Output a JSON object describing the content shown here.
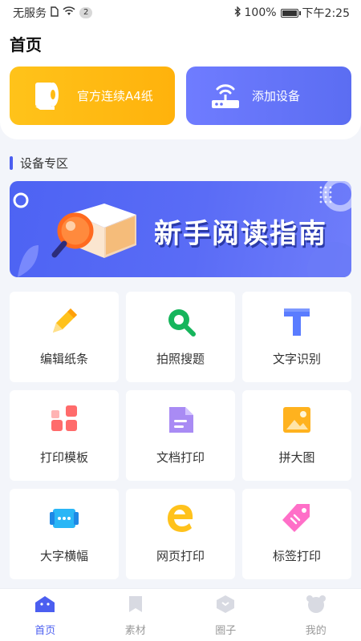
{
  "status_bar": {
    "carrier": "无服务",
    "notification_count": "2",
    "battery": "100%",
    "time": "下午2:25"
  },
  "header": {
    "title": "首页"
  },
  "quick_actions": [
    {
      "label": "官方连续A4纸",
      "icon": "paper-roll-icon",
      "color": "#ffbb14"
    },
    {
      "label": "添加设备",
      "icon": "router-icon",
      "color": "#6473f8"
    }
  ],
  "section": {
    "label": "设备专区"
  },
  "banner": {
    "text": "新手阅读指南"
  },
  "tools": [
    {
      "label": "编辑纸条",
      "icon": "pencil-icon"
    },
    {
      "label": "拍照搜题",
      "icon": "search-icon"
    },
    {
      "label": "文字识别",
      "icon": "text-t-icon"
    },
    {
      "label": "打印模板",
      "icon": "template-icon"
    },
    {
      "label": "文档打印",
      "icon": "document-icon"
    },
    {
      "label": "拼大图",
      "icon": "image-icon"
    },
    {
      "label": "大字横幅",
      "icon": "banner-icon"
    },
    {
      "label": "网页打印",
      "icon": "web-e-icon"
    },
    {
      "label": "标签打印",
      "icon": "tag-icon"
    }
  ],
  "bottom_nav": [
    {
      "label": "首页",
      "active": true
    },
    {
      "label": "素材",
      "active": false
    },
    {
      "label": "圈子",
      "active": false
    },
    {
      "label": "我的",
      "active": false
    }
  ],
  "colors": {
    "accent": "#4b5ef0",
    "paper_card": "#ffbb14",
    "device_card": "#6473f8"
  }
}
